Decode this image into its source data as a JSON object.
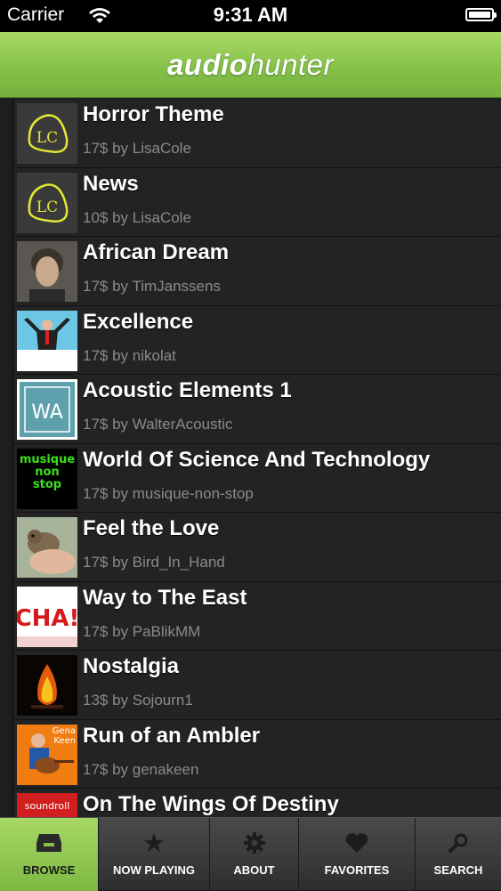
{
  "status": {
    "carrier": "Carrier",
    "time": "9:31 AM"
  },
  "header": {
    "brand_bold": "audio",
    "brand_light": "hunter"
  },
  "tracks": [
    {
      "title": "Horror Theme",
      "subtitle": "17$ by LisaCole",
      "thumb": "lc-logo"
    },
    {
      "title": "News",
      "subtitle": "10$ by LisaCole",
      "thumb": "lc-logo"
    },
    {
      "title": "African Dream",
      "subtitle": "17$ by TimJanssens",
      "thumb": "portrait-photo"
    },
    {
      "title": "Excellence",
      "subtitle": "17$ by nikolat",
      "thumb": "businessman-photo"
    },
    {
      "title": "Acoustic Elements 1",
      "subtitle": "17$ by WalterAcoustic",
      "thumb": "wa-logo"
    },
    {
      "title": "World Of Science And Technology",
      "subtitle": "17$ by musique-non-stop",
      "thumb": "musique-non-stop-logo"
    },
    {
      "title": "Feel the Love",
      "subtitle": "17$ by Bird_In_Hand",
      "thumb": "bird-photo"
    },
    {
      "title": "Way to The East",
      "subtitle": "17$ by PaBlikMM",
      "thumb": "cha-logo"
    },
    {
      "title": "Nostalgia",
      "subtitle": "13$ by Sojourn1",
      "thumb": "campfire-photo"
    },
    {
      "title": "Run of an Ambler",
      "subtitle": "17$ by genakeen",
      "thumb": "guitarist-photo"
    },
    {
      "title": "On The Wings Of Destiny",
      "subtitle": "",
      "thumb": "soundroll-logo"
    }
  ],
  "thumb_text": {
    "lc": "LC",
    "wa": "WA",
    "mns": [
      "musique",
      "non",
      "stop"
    ],
    "cha": "CHA!",
    "gena": [
      "Gena",
      "Keen"
    ],
    "soundroll": "soundroll"
  },
  "tabs": [
    {
      "label": "BROWSE",
      "icon": "inbox-icon",
      "active": true
    },
    {
      "label": "NOW PLAYING",
      "icon": "star-icon",
      "active": false
    },
    {
      "label": "ABOUT",
      "icon": "gear-icon",
      "active": false
    },
    {
      "label": "FAVORITES",
      "icon": "heart-icon",
      "active": false
    },
    {
      "label": "SEARCH",
      "icon": "search-icon",
      "active": false
    }
  ],
  "colors": {
    "accent_green": "#86c24a",
    "background": "#232323",
    "subtitle_gray": "#8a8a8a"
  }
}
